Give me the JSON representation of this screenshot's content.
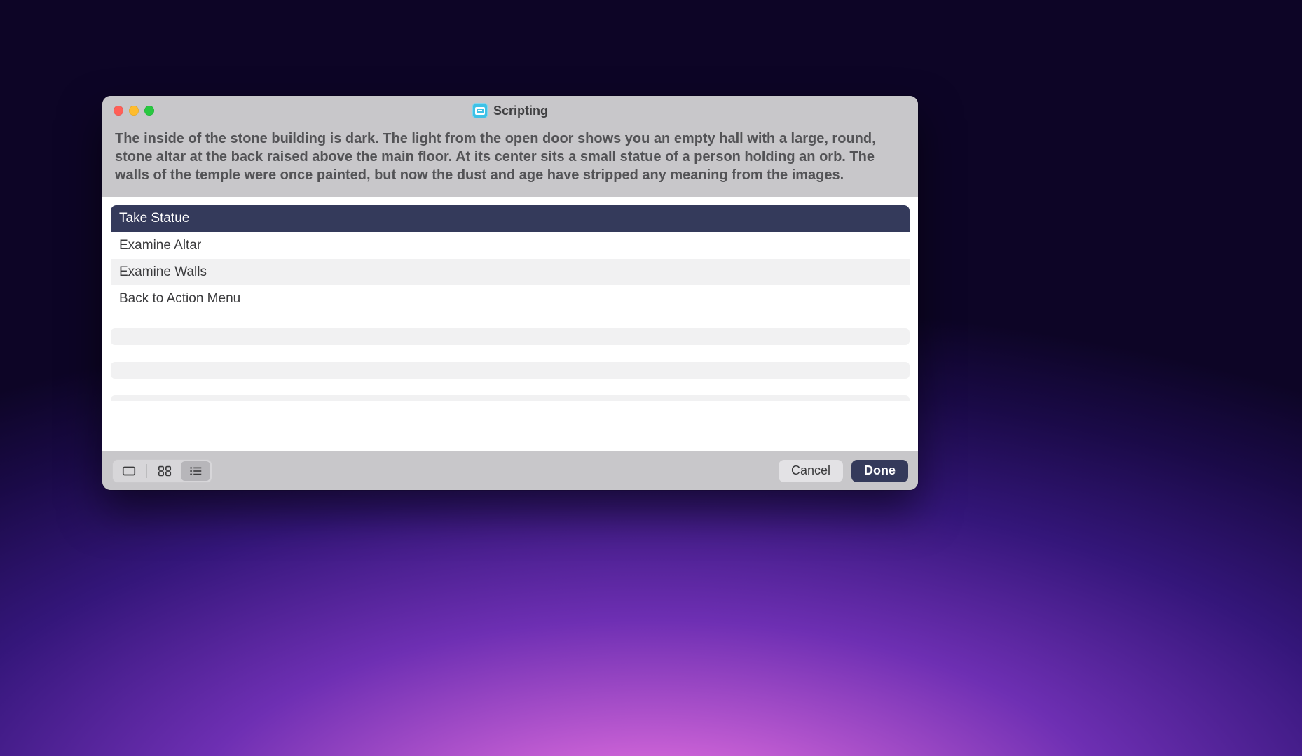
{
  "window": {
    "title": "Scripting"
  },
  "narrative": "The inside of the stone building is dark. The light from the open door shows you an empty hall with a large, round, stone altar at the back raised above the main floor.  At its center sits a small statue of a person holding an orb.  The walls of the temple were once painted, but now the dust and age have stripped any meaning from the images.",
  "options": [
    {
      "label": "Take Statue",
      "selected": true
    },
    {
      "label": "Examine Altar",
      "selected": false
    },
    {
      "label": "Examine Walls",
      "selected": false
    },
    {
      "label": "Back to Action Menu",
      "selected": false
    }
  ],
  "footer": {
    "cancel": "Cancel",
    "done": "Done"
  }
}
